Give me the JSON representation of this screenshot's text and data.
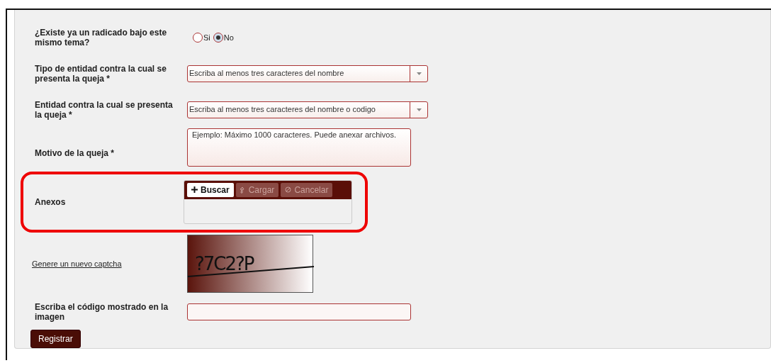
{
  "form": {
    "fields": [
      {
        "kind": "radio",
        "label": "¿Existe ya un radicado bajo este mismo tema?",
        "options": [
          {
            "label": "Si",
            "selected": false
          },
          {
            "label": "No",
            "selected": true
          }
        ]
      },
      {
        "kind": "select",
        "label": "Tipo de entidad contra la cual se presenta la queja *",
        "placeholder": "Escriba al menos tres caracteres del nombre"
      },
      {
        "kind": "select",
        "label": "Entidad contra la cual se presenta la queja *",
        "placeholder": "Escriba al menos tres caracteres del nombre o codigo"
      },
      {
        "kind": "textarea",
        "label": "Motivo de la queja *",
        "placeholder": "Ejemplo: Máximo 1000 caracteres. Puede anexar archivos."
      },
      {
        "kind": "upload",
        "label": "Anexos",
        "highlighted": true,
        "buttons": [
          {
            "kind": "browse",
            "label": "Buscar",
            "disabled": false
          },
          {
            "kind": "upload",
            "label": "Cargar",
            "disabled": true
          },
          {
            "kind": "cancel",
            "label": "Cancelar",
            "disabled": true
          }
        ]
      },
      {
        "kind": "captcha",
        "link": "Genere un nuevo captcha",
        "code": "?7C2?P"
      },
      {
        "kind": "text",
        "label": "Escriba el código mostrado en la imagen"
      }
    ],
    "submit": "Registrar"
  }
}
